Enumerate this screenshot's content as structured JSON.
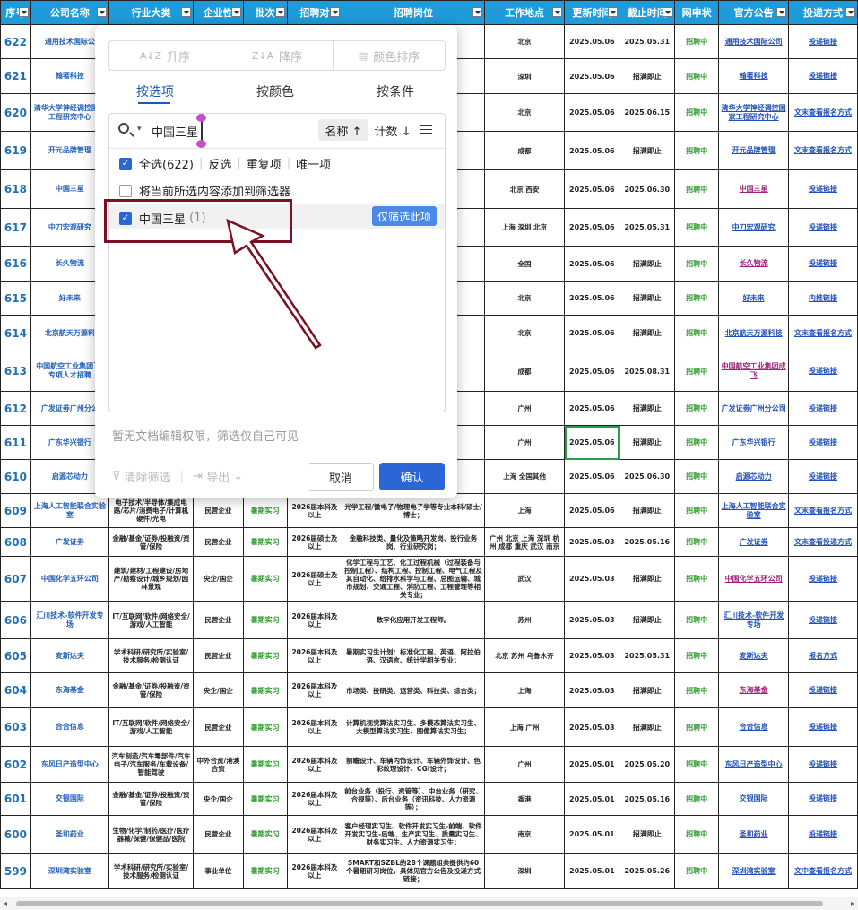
{
  "headers": [
    "序号",
    "公司名称",
    "行业大类",
    "企业性",
    "批次",
    "招聘对",
    "招聘岗位",
    "工作地点",
    "更新时间",
    "截止时间",
    "网申状",
    "官方公告",
    "投递方式"
  ],
  "rows": [
    {
      "seq": "622",
      "company": "通用技术国际公",
      "industry": "",
      "nature": "",
      "batch": "",
      "target": "",
      "position": "35 \"",
      "location": "北京",
      "updated": "2025.05.06",
      "deadline": "2025.05.31",
      "status": "招聘中",
      "notice": "通用技术国际公司",
      "apply": "投递链接",
      "tall": false
    },
    {
      "seq": "621",
      "company": "翰著科技",
      "industry": "",
      "nature": "",
      "batch": "",
      "target": "",
      "position": "发类",
      "location": "深圳",
      "updated": "2025.05.06",
      "deadline": "招满即止",
      "status": "招聘中",
      "notice": "翰著科技",
      "apply": "投递链接",
      "tall": false
    },
    {
      "seq": "620",
      "company": "清华大学神经调控国家工程研究中心",
      "industry": "",
      "nature": "",
      "batch": "",
      "target": "",
      "position": "动化优秀",
      "location": "北京",
      "updated": "2025.05.06",
      "deadline": "2025.06.15",
      "status": "招聘中",
      "notice": "清华大学神经调控国家工程研究中心",
      "apply": "文末查看报名方式",
      "tall": false
    },
    {
      "seq": "619",
      "company": "开元品牌管理",
      "industry": "",
      "nature": "",
      "batch": "",
      "target": "",
      "position": "生、习生",
      "location": "成都",
      "updated": "2025.05.06",
      "deadline": "招满即止",
      "status": "招聘中",
      "notice": "开元品牌管理",
      "apply": "文末查看报名方式",
      "tall": false
    },
    {
      "seq": "618",
      "company": "中国三星",
      "industry": "",
      "nature": "",
      "batch": "",
      "target": "",
      "position": "能；",
      "location": "北京 西安",
      "updated": "2025.05.06",
      "deadline": "2025.06.30",
      "status": "招聘中",
      "notice": "中国三星",
      "apply": "投递链接",
      "tall": false,
      "mg": true
    },
    {
      "seq": "617",
      "company": "中刀宏观研究",
      "industry": "",
      "nature": "",
      "batch": "",
      "target": "",
      "position": "分析、中观研",
      "location": "上海 深圳 北京",
      "updated": "2025.05.06",
      "deadline": "2025.05.31",
      "status": "招聘中",
      "notice": "中刀宏观研究",
      "apply": "投递链接",
      "tall": false
    },
    {
      "seq": "616",
      "company": "长久物流",
      "industry": "",
      "nature": "",
      "batch": "",
      "target": "",
      "position": "",
      "location": "全国",
      "updated": "2025.05.06",
      "deadline": "招满即止",
      "status": "招聘中",
      "notice": "长久物流",
      "apply": "投递链接",
      "tall": false,
      "mg": true
    },
    {
      "seq": "615",
      "company": "好未来",
      "industry": "",
      "nature": "",
      "batch": "",
      "target": "",
      "position": "端、",
      "location": "北京",
      "updated": "2025.05.06",
      "deadline": "招满即止",
      "status": "招聘中",
      "notice": "好未来",
      "apply": "内推链接",
      "tall": false
    },
    {
      "seq": "614",
      "company": "北京航天万源科",
      "industry": "",
      "nature": "",
      "batch": "",
      "target": "",
      "position": "路设路设智能",
      "location": "北京",
      "updated": "2025.05.06",
      "deadline": "招满即止",
      "status": "招聘中",
      "notice": "北京航天万源科技",
      "apply": "文末查看报名方式",
      "tall": false
    },
    {
      "seq": "613",
      "company": "中国航空工业集团飞-专项人才招聘",
      "industry": "",
      "nature": "",
      "batch": "",
      "target": "",
      "position": "、火机安控制、热",
      "location": "成都",
      "updated": "2025.05.06",
      "deadline": "2025.08.31",
      "status": "招聘中",
      "notice": "中国航空工业集团成飞",
      "apply": "投递链接",
      "tall": false,
      "mg": true
    },
    {
      "seq": "612",
      "company": "广发证劵广州分公",
      "industry": "",
      "nature": "",
      "batch": "",
      "target": "",
      "position": "",
      "location": "广州",
      "updated": "2025.05.06",
      "deadline": "招满即止",
      "status": "招聘中",
      "notice": "广发证劵广州分公司",
      "apply": "投递链接",
      "tall": false
    },
    {
      "seq": "611",
      "company": "广东华兴银行",
      "industry": "",
      "nature": "",
      "batch": "",
      "target": "",
      "position": "E；",
      "location": "广州",
      "updated": "2025.05.06",
      "deadline": "招满即止",
      "status": "招聘中",
      "notice": "广东华兴银行",
      "apply": "投递链接",
      "tall": false,
      "sel": true
    },
    {
      "seq": "610",
      "company": "启源芯动力",
      "industry": "",
      "nature": "",
      "batch": "",
      "target": "",
      "position": "、面",
      "location": "上海 全国其他",
      "updated": "2025.05.06",
      "deadline": "2025.06.30",
      "status": "招聘中",
      "notice": "启源芯动力",
      "apply": "投递链接",
      "tall": false
    },
    {
      "seq": "609",
      "company": "上海人工智能联合实验室",
      "industry": "电子技术/半导体/集成电路/芯片/消费电子/计算机硬件/光电",
      "nature": "民营企业",
      "batch": "暑期实习",
      "target": "2026届本科及以上",
      "position": "光学工程/微电子/物理电子学等专业本科/硕士/博士；",
      "location": "上海",
      "updated": "2025.05.06",
      "deadline": "招满即止",
      "status": "招聘中",
      "notice": "上海人工智能联合实验室",
      "apply": "文末查看报名方式"
    },
    {
      "seq": "608",
      "company": "广发证劵",
      "industry": "金融/基金/证券/投融资/资管/保险",
      "nature": "民营企业",
      "batch": "暑期实习",
      "target": "2026届硕士及以上",
      "position": "金融科技类、量化及策略开发岗、投行业务岗、行业研究岗；",
      "location": "广州 北京 上海 深圳 杭州 成都 重庆 武汉 南京",
      "updated": "2025.05.03",
      "deadline": "2025.05.16",
      "status": "招聘中",
      "notice": "广发证劵",
      "apply": "文末查看投递方式"
    },
    {
      "seq": "607",
      "company": "中国化学五环公司",
      "industry": "建筑/建材/工程建设/房地产/勘察设计/城乡规划/园林景观",
      "nature": "央企/国企",
      "batch": "暑期实习",
      "target": "2026届硕士及以上",
      "position": "化学工程与工艺、化工过程机械（过程装备与控制工程）、结构工程、控制工程、电气工程及其自动化、给排水科学与工程、总图运输、城市规划、交通工程、消防工程、工程管理等相关专业；",
      "location": "武汉",
      "updated": "2025.05.03",
      "deadline": "招满即止",
      "status": "招聘中",
      "notice": "中国化学五环公司",
      "apply": "投递链接",
      "mg": true
    },
    {
      "seq": "606",
      "company": "汇川技术-软件开发专场",
      "industry": "IT/互联网/软件/网络安全/游戏/人工智能",
      "nature": "民营企业",
      "batch": "暑期实习",
      "target": "2026届本科及以上",
      "position": "数字化应用开发工程师。",
      "location": "苏州",
      "updated": "2025.05.03",
      "deadline": "招满即止",
      "status": "招聘中",
      "notice": "汇川技术-软件开发专场",
      "apply": "投递链接"
    },
    {
      "seq": "605",
      "company": "麦斯达夫",
      "industry": "学术科研/研究所/实验室/技术服务/检测认证",
      "nature": "民营企业",
      "batch": "暑期实习",
      "target": "2026届本科及以上",
      "position": "暑期实习生计划：标准化工程、英语、阿拉伯语、汉语言、统计学相关专业；",
      "location": "北京 苏州 乌鲁木齐",
      "updated": "2025.05.03",
      "deadline": "2025.05.31",
      "status": "招聘中",
      "notice": "麦斯达夫",
      "apply": "报名方式"
    },
    {
      "seq": "604",
      "company": "东海基金",
      "industry": "金融/基金/证券/投融资/资管/保险",
      "nature": "央企/国企",
      "batch": "暑期实习",
      "target": "2026届本科及以上",
      "position": "市场类、投研类、运营类、科技类、综合类；",
      "location": "上海",
      "updated": "2025.05.03",
      "deadline": "招满即止",
      "status": "招聘中",
      "notice": "东海基金",
      "apply": "投递链接",
      "mg": true
    },
    {
      "seq": "603",
      "company": "合合信息",
      "industry": "IT/互联网/软件/网络安全/游戏/人工智能",
      "nature": "民营企业",
      "batch": "暑期实习",
      "target": "2026届本科及以上",
      "position": "计算机视觉算法实习生、多模态算法实习生、大模型算法实习生、图像算法实习生；",
      "location": "上海 广州",
      "updated": "2025.05.03",
      "deadline": "招满即止",
      "status": "招聘中",
      "notice": "合合信息",
      "apply": "投递链接"
    },
    {
      "seq": "602",
      "company": "东风日产造型中心",
      "industry": "汽车制造/汽车零部件/汽车电子/汽车服务/车载设备/智能驾驶",
      "nature": "中外合资/港澳合资",
      "batch": "暑期实习",
      "target": "2026届本科及以上",
      "position": "前瞻设计、车辆内饰设计、车辆外饰设计、色彩纹理设计、CGI设计；",
      "location": "广州",
      "updated": "2025.05.01",
      "deadline": "2025.05.20",
      "status": "招聘中",
      "notice": "东风日产造型中心",
      "apply": "投递链接"
    },
    {
      "seq": "601",
      "company": "交银国际",
      "industry": "金融/基金/证券/投融资/资管/保险",
      "nature": "央企/国企",
      "batch": "暑期实习",
      "target": "2026届本科及以上",
      "position": "前台业务（投行、资管等）、中台业务（研究、合规等）、后台业务（资讯科技、人力资源等）；",
      "location": "香港",
      "updated": "2025.05.01",
      "deadline": "2025.05.16",
      "status": "招聘中",
      "notice": "交银国际",
      "apply": "投递链接"
    },
    {
      "seq": "600",
      "company": "圣和药业",
      "industry": "生物/化学/制药/医疗/医疗器械/保健/保健品/医院",
      "nature": "民营企业",
      "batch": "暑期实习",
      "target": "2026届本科及以上",
      "position": "客户经理实习生、软件开发实习生-前端、软件开发实习生-后端、生产实习生、质量实习生、财务实习生、人力资源实习生；",
      "location": "南京",
      "updated": "2025.05.01",
      "deadline": "招满即止",
      "status": "招聘中",
      "notice": "圣和药业",
      "apply": "投递链接"
    },
    {
      "seq": "599",
      "company": "深圳湾实验室",
      "industry": "学术科研/研究所/实验室/技术服务/检测认证",
      "nature": "事业单位",
      "batch": "暑期实习",
      "target": "2026届本科及以上",
      "position": "SMART和SZBL的28个课题组共提供约60个暑期研习岗位，具体见官方公告及投递方式链接；",
      "location": "深圳",
      "updated": "2025.05.01",
      "deadline": "2025.05.26",
      "status": "招聘中",
      "notice": "深圳湾实验室",
      "apply": "文中查看报名方式"
    }
  ],
  "dialog": {
    "sort_asc": "升序",
    "sort_desc": "降序",
    "sort_color": "颜色排序",
    "tab_values": "按选项",
    "tab_color": "按颜色",
    "tab_condition": "按条件",
    "search_value": "中国三星",
    "name_sort": "名称 ↑",
    "count_sort": "计数 ↓",
    "select_all": "全选(622)",
    "invert": "反选",
    "duplicates": "重复项",
    "unique": "唯一项",
    "add_to_filter": "将当前所选内容添加到筛选器",
    "item_label": "中国三星",
    "item_count": "(1)",
    "only_this": "仅筛选此项",
    "note": "暂无文档编辑权限，筛选仅自己可见",
    "clear_filter": "清除筛选",
    "export": "导出",
    "cancel": "取消",
    "confirm": "确认"
  },
  "colors": {
    "header_bg": "#1f9bd9",
    "accent": "#2a66d6",
    "highlight_box": "#7a1024",
    "status_green": "#2e9a2e"
  }
}
